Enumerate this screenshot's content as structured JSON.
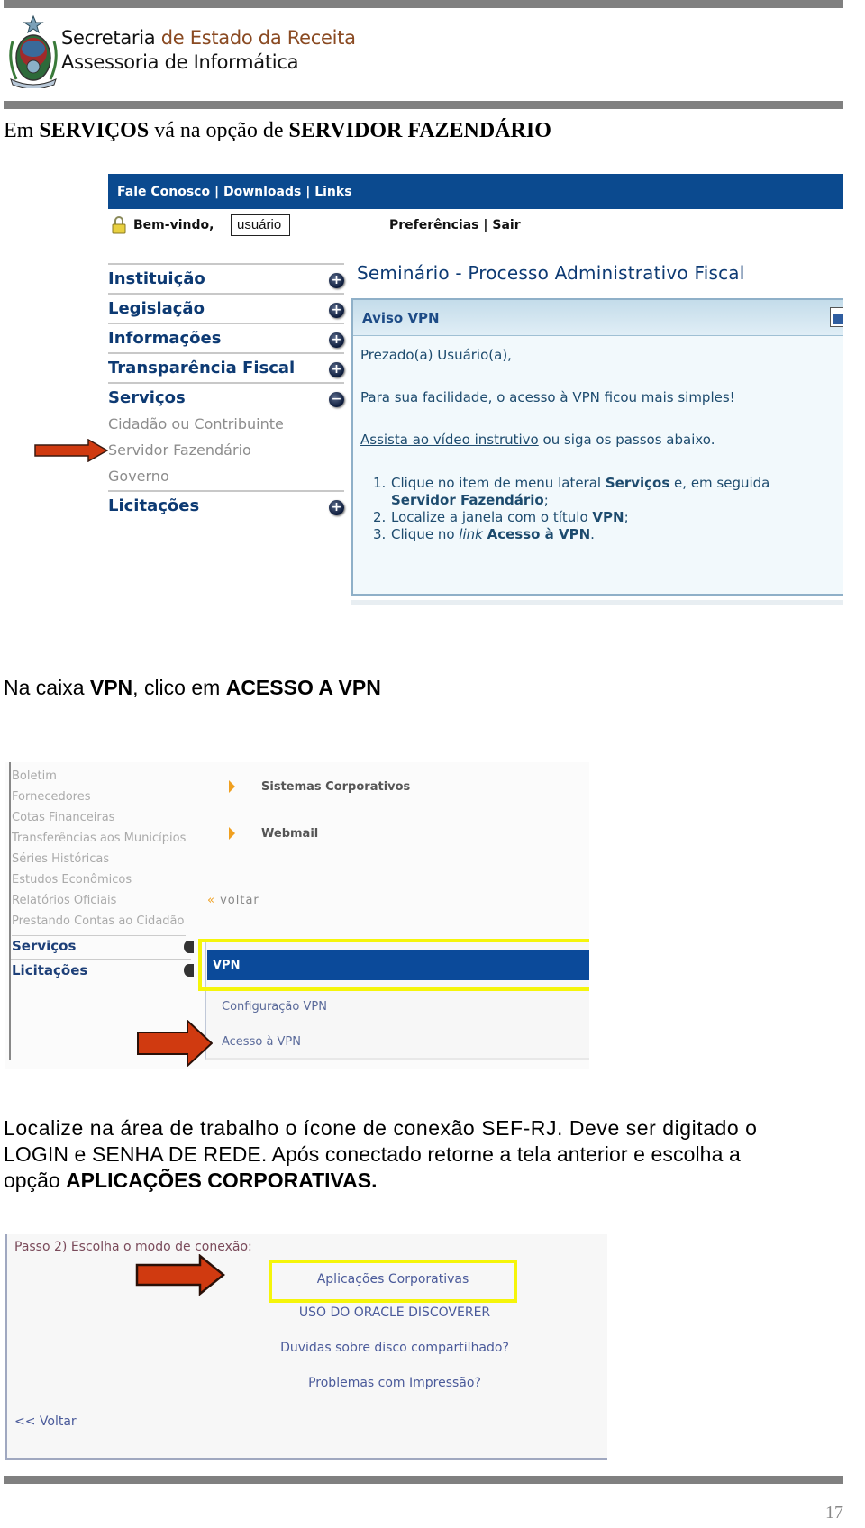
{
  "header": {
    "org_line1_part1": "Secretaria ",
    "org_line1_part2": "de Estado da Receita",
    "org_line2": "Assessoria de Informática",
    "accent_color": "#8a4a22"
  },
  "step1": {
    "instruction_part1": "Em ",
    "instruction_bold1": "SERVIÇOS",
    "instruction_part2": " vá na opção de ",
    "instruction_bold2": "SERVIDOR FAZENDÁRIO",
    "screenshot": {
      "topnav": {
        "item1": "Fale Conosco",
        "sep": " | ",
        "item2": "Downloads",
        "item3": "Links"
      },
      "welcome_label": "Bem-vindo,",
      "username": "usuário",
      "prefs": "Preferências",
      "sep": " | ",
      "logout": "Sair",
      "menu": [
        {
          "label": "Instituição",
          "icon": "+"
        },
        {
          "label": "Legislação",
          "icon": "+"
        },
        {
          "label": "Informações",
          "icon": "+"
        },
        {
          "label": "Transparência Fiscal",
          "icon": "+"
        },
        {
          "label": "Serviços",
          "icon": "−"
        },
        {
          "label": "Licitações",
          "icon": "+"
        }
      ],
      "submenu": [
        "Cidadão ou Contribuinte",
        "Servidor Fazendário",
        "Governo"
      ],
      "page_title": "Seminário - Processo Administrativo Fiscal",
      "aviso": {
        "title": "Aviso VPN",
        "greeting": "Prezado(a) Usuário(a),",
        "intro": "Para sua facilidade, o acesso à VPN ficou mais simples!",
        "video_link": "Assista ao vídeo instrutivo",
        "video_rest": " ou siga os passos abaixo.",
        "steps": [
          {
            "num": "1.",
            "text1": "Clique no item de menu lateral ",
            "bold1": "Serviços",
            "text2": " e, em seguida",
            "bold2": "Servidor Fazendário",
            "text3": ";"
          },
          {
            "num": "2.",
            "text1": "Localize a janela com o título ",
            "bold1": "VPN",
            "text2": ";"
          },
          {
            "num": "3.",
            "text1": "Clique no ",
            "italic": "link",
            "text2": " ",
            "bold1": "Acesso à VPN",
            "text3": "."
          }
        ]
      }
    }
  },
  "step2": {
    "instruction_part1": "Na caixa ",
    "instruction_bold1": "VPN",
    "instruction_part2": ", clico em ",
    "instruction_bold2": "ACESSO A VPN",
    "screenshot": {
      "side_items": [
        "Boletim",
        "Fornecedores",
        "Cotas Financeiras",
        "Transferências aos Municípios",
        "Séries Históricas",
        "Estudos Econômicos",
        "Relatórios Oficiais",
        "Prestando Contas ao Cidadão"
      ],
      "servicos": "Serviços",
      "licitacoes": "Licitações",
      "links": [
        "Sistemas Corporativos",
        "Webmail"
      ],
      "voltar_arrow": "«",
      "voltar": "voltar",
      "vpn_title": "VPN",
      "vpn_links": [
        "Configuração VPN",
        "Acesso à VPN"
      ]
    }
  },
  "step3": {
    "paragraph_line1": "Localize na área de trabalho o ícone de conexão SEF-RJ. Deve ser digitado o",
    "paragraph_line2": "LOGIN e SENHA DE REDE. Após conectado retorne a tela anterior e escolha a",
    "paragraph_line3_part1": "opção ",
    "paragraph_line3_bold": "APLICAÇÕES CORPORATIVAS.",
    "screenshot": {
      "passo": "Passo 2) Escolha o modo de conexão:",
      "options": [
        "Aplicações Corporativas",
        "USO DO ORACLE DISCOVERER",
        "Duvidas sobre disco compartilhado?",
        "Problemas com Impressão?"
      ],
      "voltar": "<< Voltar"
    }
  },
  "page_number": "17"
}
